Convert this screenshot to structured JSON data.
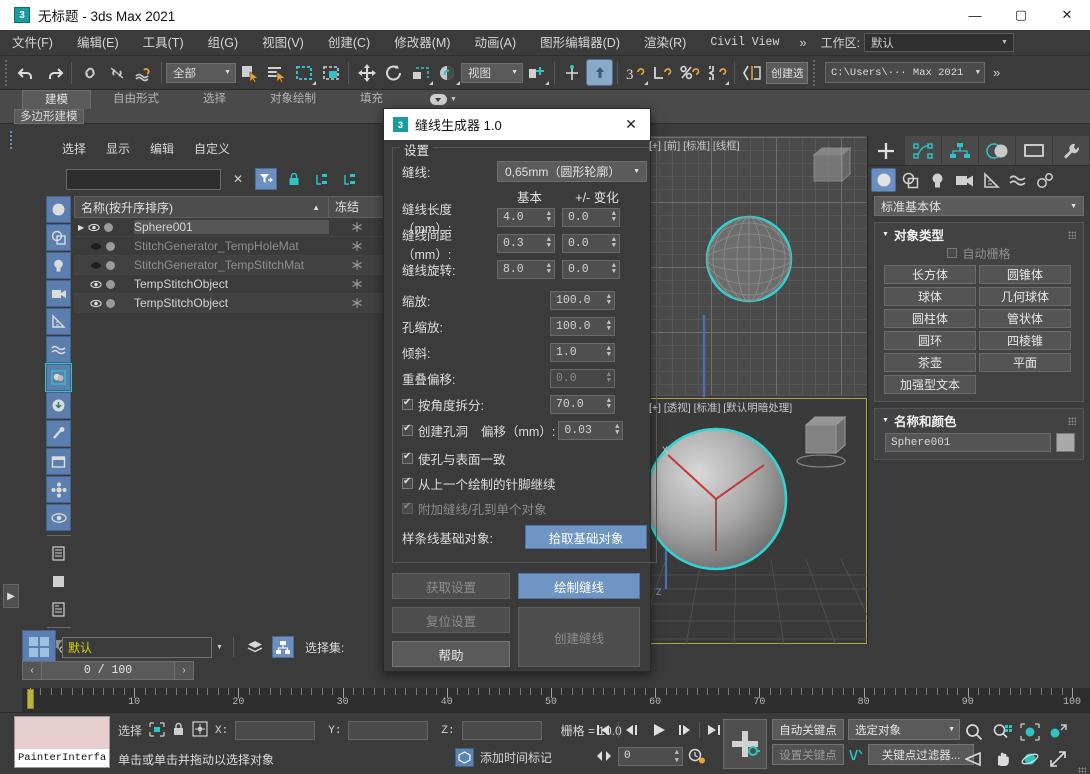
{
  "window": {
    "title": "无标题 - 3ds Max 2021",
    "logo_text": "3",
    "minimize": "—",
    "maximize": "▢",
    "close": "✕"
  },
  "menubar": {
    "items": [
      {
        "label": "文件(F)"
      },
      {
        "label": "编辑(E)"
      },
      {
        "label": "工具(T)"
      },
      {
        "label": "组(G)"
      },
      {
        "label": "视图(V)"
      },
      {
        "label": "创建(C)"
      },
      {
        "label": "修改器(M)"
      },
      {
        "label": "动画(A)"
      },
      {
        "label": "图形编辑器(D)"
      },
      {
        "label": "渲染(R)"
      },
      {
        "label": "Civil View"
      }
    ],
    "overflow": "»",
    "workspace_label": "工作区:",
    "workspace_value": "默认"
  },
  "toolbar": {
    "selection_filter": "全部",
    "ref_coord_system": "视图",
    "create_selection_set": "创建选择集",
    "scene_path": "C:\\Users\\··· Max 2021",
    "overflow": "»"
  },
  "ribbon": {
    "tabs": [
      {
        "label": "建模",
        "selected": true
      },
      {
        "label": "自由形式",
        "selected": false
      },
      {
        "label": "选择",
        "selected": false
      },
      {
        "label": "对象绘制",
        "selected": false
      },
      {
        "label": "填充",
        "selected": false
      }
    ],
    "subtab": "多边形建模"
  },
  "explorer": {
    "menus": [
      "选择",
      "显示",
      "编辑",
      "自定义"
    ],
    "search_value": "",
    "columns": {
      "name": "名称(按升序排序)",
      "frozen": "冻结"
    },
    "rows": [
      {
        "name": "Sphere001",
        "selected": true,
        "dim": false,
        "visible": true,
        "expandable": true
      },
      {
        "name": "StitchGenerator_TempHoleMat",
        "selected": false,
        "dim": true,
        "visible": false,
        "expandable": false
      },
      {
        "name": "StitchGenerator_TempStitchMat",
        "selected": false,
        "dim": true,
        "visible": false,
        "expandable": false
      },
      {
        "name": "TempStitchObject",
        "selected": false,
        "dim": false,
        "visible": true,
        "expandable": false
      },
      {
        "name": "TempStitchObject",
        "selected": false,
        "dim": false,
        "visible": true,
        "expandable": false
      }
    ]
  },
  "viewports": [
    {
      "label": "[+] [前] [标准] [线框]",
      "name": "front-viewport"
    },
    {
      "label": "[+] [透视] [标准] [默认明暗处理]",
      "name": "perspective-viewport"
    }
  ],
  "command_panel": {
    "category": "标准基本体",
    "object_type": {
      "title": "对象类型",
      "autogrid": "自动栅格",
      "buttons": [
        "长方体",
        "圆锥体",
        "球体",
        "几何球体",
        "圆柱体",
        "管状体",
        "圆环",
        "四棱锥",
        "茶壶",
        "平面",
        "加强型文本"
      ]
    },
    "name_color": {
      "title": "名称和颜色",
      "name_value": "Sphere001",
      "color": "#a9a9a9"
    }
  },
  "dialog": {
    "title": "缝线生成器 1.0",
    "logo_text": "3",
    "close": "✕",
    "group_title": "设置",
    "stitch_label": "缝线:",
    "stitch_value": "0,65mm（圆形轮廓）",
    "col_base": "基本",
    "col_variation": "+/- 变化",
    "fields": [
      {
        "label": "缝线长度（mm）:",
        "base": "4.0",
        "variation": "0.0",
        "disabled": false
      },
      {
        "label": "缝线间距（mm）:",
        "base": "0.3",
        "variation": "0.0",
        "disabled": false
      },
      {
        "label": "缝线旋转:",
        "base": "8.0",
        "variation": "0.0",
        "disabled": false
      }
    ],
    "single_fields": [
      {
        "label": "缩放:",
        "value": "100.0",
        "disabled": false
      },
      {
        "label": "孔缩放:",
        "value": "100.0",
        "disabled": false
      },
      {
        "label": "倾斜:",
        "value": "1.0",
        "disabled": false
      },
      {
        "label": "重叠偏移:",
        "value": "0.0",
        "disabled": true
      }
    ],
    "angle_split": {
      "label": "按角度拆分:",
      "value": "70.0",
      "checked": true
    },
    "create_holes": {
      "label": "创建孔洞",
      "offset_label": "偏移（mm）:",
      "offset_value": "0.03",
      "checked": true
    },
    "conform_holes": {
      "label": "使孔与表面一致",
      "checked": true
    },
    "continue_stitch": {
      "label": "从上一个绘制的针脚继续",
      "checked": true
    },
    "attach_single": {
      "label": "附加缝线/孔到单个对象",
      "checked": true,
      "disabled": true
    },
    "spline_base_label": "样条线基础对象:",
    "pick_base_button": "拾取基础对象",
    "buttons": [
      {
        "label": "获取设置",
        "style": "disabled"
      },
      {
        "label": "绘制缝线",
        "style": "blue"
      },
      {
        "label": "复位设置",
        "style": "disabled"
      },
      {
        "label": "创建缝线",
        "style": "disabled-large"
      },
      {
        "label": "帮助",
        "style": "normal"
      }
    ]
  },
  "timeline": {
    "frame_display": "0 / 100",
    "prev": "‹",
    "next": "›",
    "ticks": [
      "10",
      "20",
      "30",
      "40",
      "50",
      "60",
      "70",
      "80",
      "90",
      "100"
    ],
    "range_start": 0,
    "range_end": 100,
    "current_frame": 0
  },
  "layer_bar": {
    "layer_value": "默认",
    "selection_set_label": "选择集:"
  },
  "statusbar": {
    "material_name": "PainterInterfa",
    "material_color": "#e8cfcf",
    "selection_label": "选择",
    "x_label": "X:",
    "y_label": "Y:",
    "z_label": "Z:",
    "x_value": "",
    "y_value": "",
    "z_value": "",
    "grid_label": "栅格 = 10.0",
    "prompt": "单击或单击并拖动以选择对象",
    "add_time_tag": "添加时间标记"
  },
  "animation": {
    "frame_value": "0",
    "auto_key": "自动关键点",
    "set_key": "设置关键点",
    "key_mode_value": "选定对象",
    "key_filters": "关键点过滤器..."
  }
}
